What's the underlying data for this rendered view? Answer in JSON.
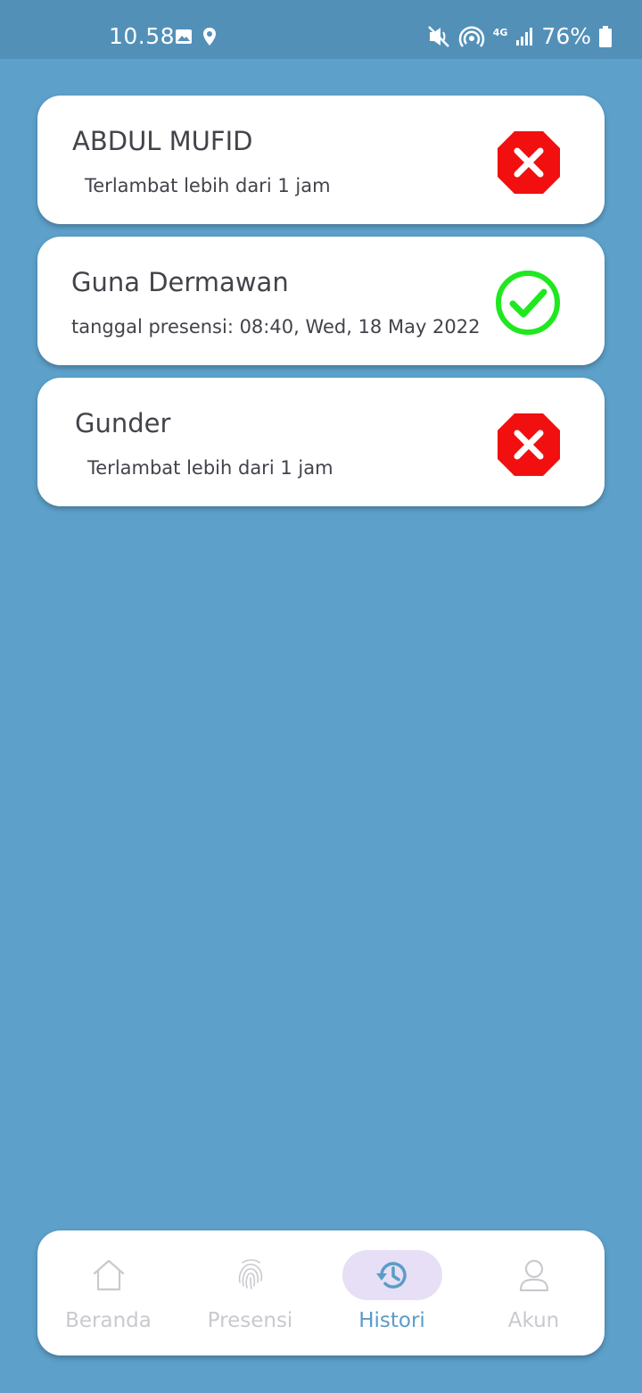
{
  "status_bar": {
    "time": "10.58",
    "network": "4G",
    "battery": "76%",
    "icons": [
      "image-icon",
      "location-pin-icon",
      "mute-vibrate-icon",
      "hotspot-icon",
      "network-4g-icon",
      "signal-icon",
      "battery-icon"
    ]
  },
  "colors": {
    "background": "#5da0ca",
    "status_bar": "#5390b8",
    "error_red": "#f20f0f",
    "success_green": "#1fe81f",
    "active_nav": "#5a9cc8",
    "active_nav_pill": "#e6dff5",
    "inactive_nav": "#c9c9cf"
  },
  "records": [
    {
      "name": "ABDUL MUFID",
      "subtitle": "Terlambat lebih dari 1 jam",
      "status": "late",
      "icon": "red-x-octagon-icon"
    },
    {
      "name": "Guna Dermawan",
      "subtitle": "tanggal presensi:  08:40, Wed, 18 May 2022",
      "status": "present",
      "icon": "green-check-circle-icon"
    },
    {
      "name": "Gunder",
      "subtitle": "Terlambat lebih dari 1 jam",
      "status": "late",
      "icon": "red-x-octagon-icon"
    }
  ],
  "nav": {
    "active": "Histori",
    "items": [
      {
        "label": "Beranda",
        "icon": "home-icon"
      },
      {
        "label": "Presensi",
        "icon": "fingerprint-icon"
      },
      {
        "label": "Histori",
        "icon": "history-icon"
      },
      {
        "label": "Akun",
        "icon": "user-icon"
      }
    ]
  }
}
